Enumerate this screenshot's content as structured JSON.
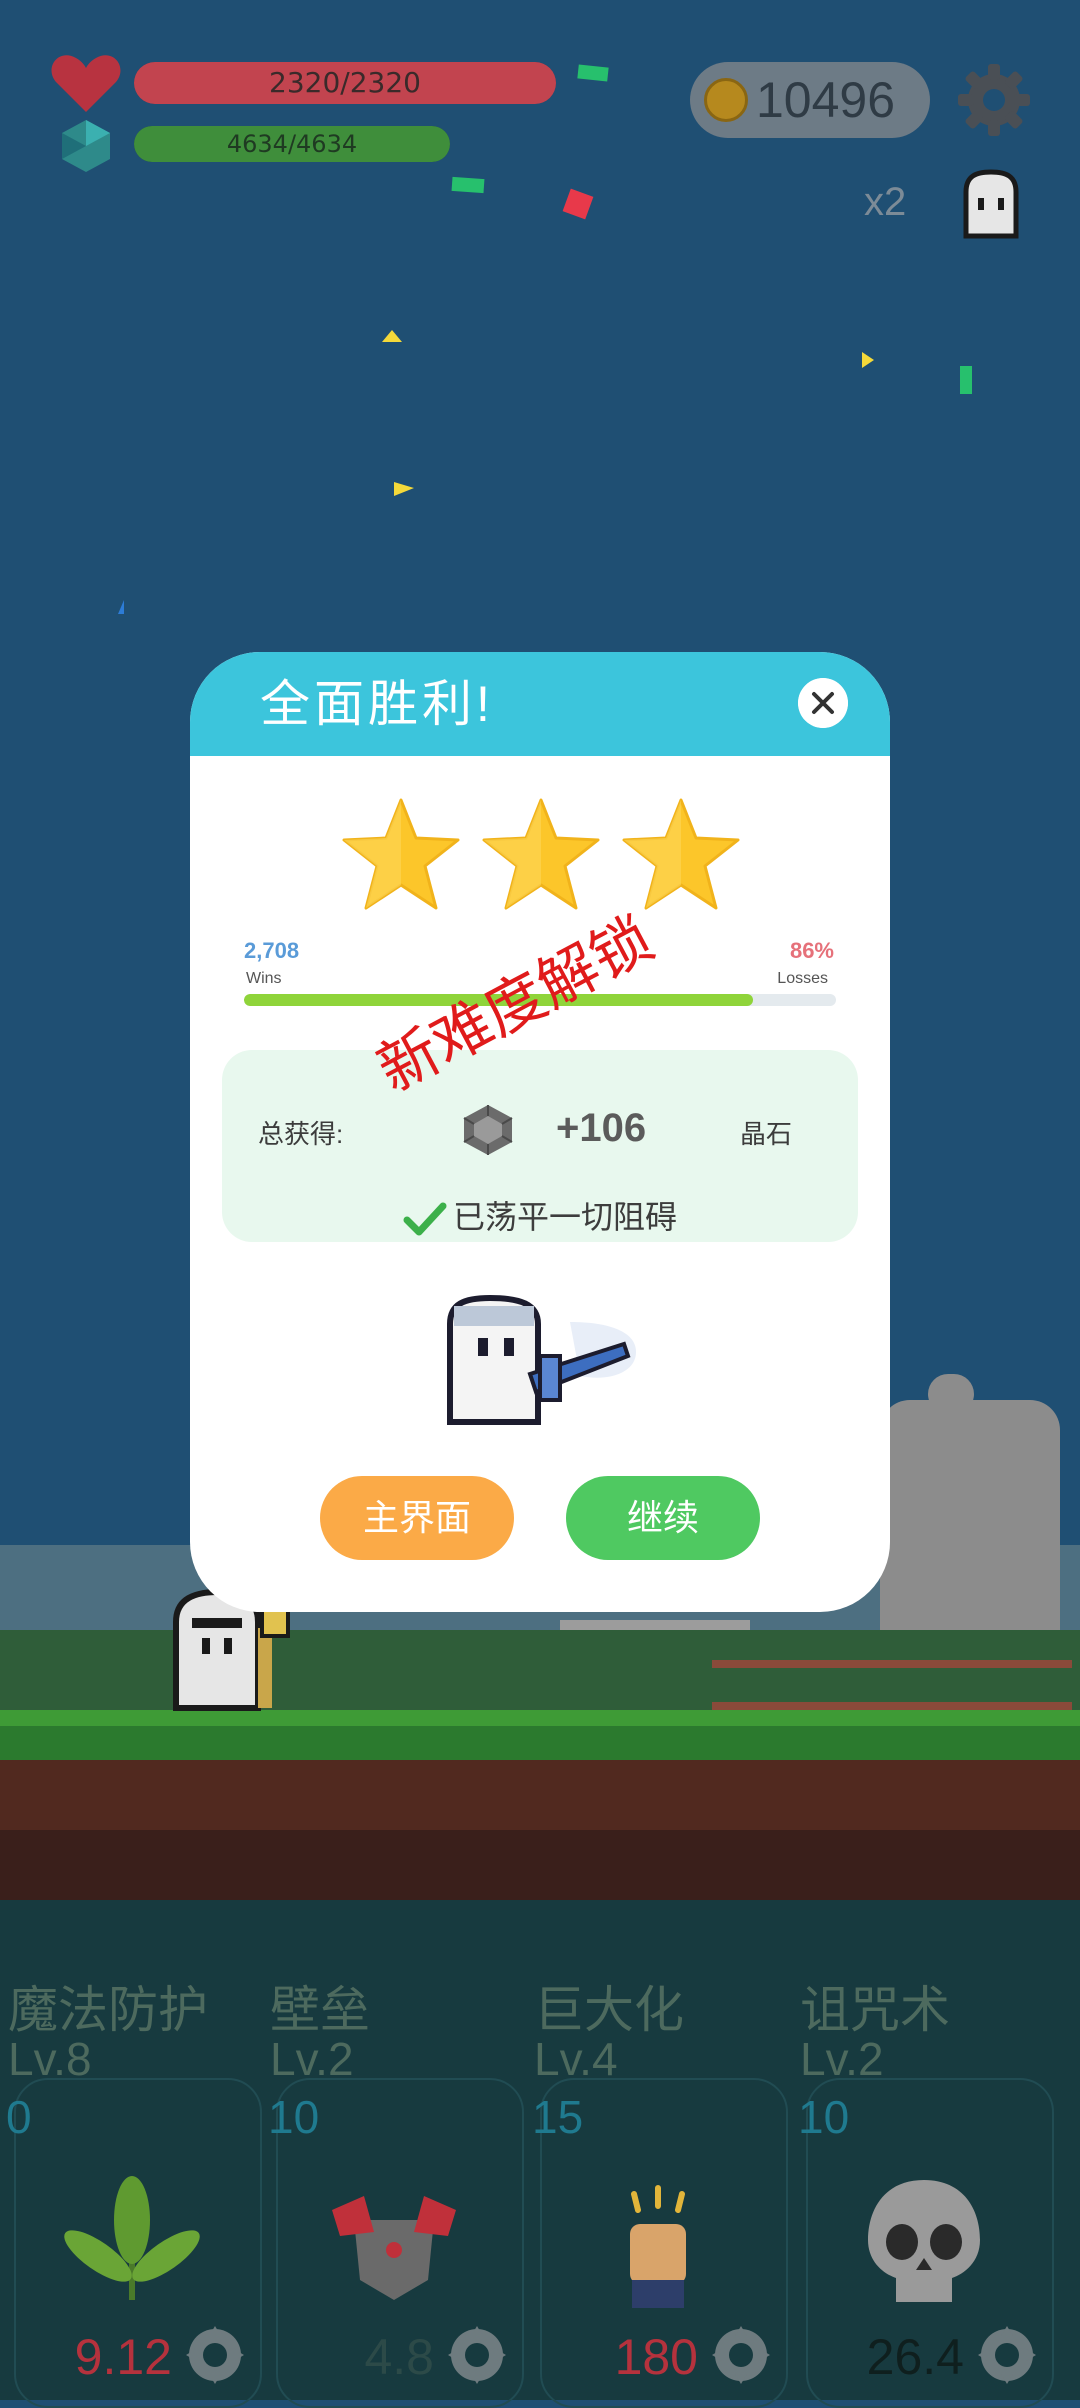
{
  "hud": {
    "hp_text": "2320/2320",
    "hp_fraction": 1.0,
    "mp_text": "4634/4634",
    "mp_fraction": 1.0,
    "coins": "10496",
    "speed": "x2",
    "icons": {
      "hp": "heart-icon",
      "mp": "crystal-icon",
      "coins": "coin-icon",
      "settings": "gear-icon",
      "companion": "ghost-icon"
    }
  },
  "dialog": {
    "title": "全面胜利!",
    "stars_earned": 3,
    "stars_total": 3,
    "wins_value": "2,708",
    "wins_label": "Wins",
    "losses_value": "86%",
    "losses_label": "Losses",
    "progress_fraction": 0.86,
    "unlock_text": "新难度解锁",
    "reward": {
      "label": "总获得:",
      "amount": "+106",
      "unit": "晶石"
    },
    "cleared_text": "已荡平一切阻碍",
    "buttons": {
      "home": "主界面",
      "continue": "继续"
    }
  },
  "skills": [
    {
      "name": "魔法防护",
      "level": "Lv.8",
      "cost": "0",
      "value": "9.12",
      "value_color": "#b5323d",
      "icon": "leaf-icon"
    },
    {
      "name": "壁垒",
      "level": "Lv.2",
      "cost": "10",
      "value": "4.8",
      "value_color": "#2c4a48",
      "icon": "armor-icon"
    },
    {
      "name": "巨大化",
      "level": "Lv.4",
      "cost": "15",
      "value": "180",
      "value_color": "#b5323d",
      "icon": "fist-icon"
    },
    {
      "name": "诅咒术",
      "level": "Lv.2",
      "cost": "10",
      "value": "26.4",
      "value_color": "#0f1f1e",
      "icon": "skull-icon"
    }
  ],
  "colors": {
    "header": "#3cc5dc",
    "home_button": "#fbaa47",
    "continue_button": "#4fc961",
    "star": "#fcc62a",
    "stamp": "#e01b1b"
  }
}
